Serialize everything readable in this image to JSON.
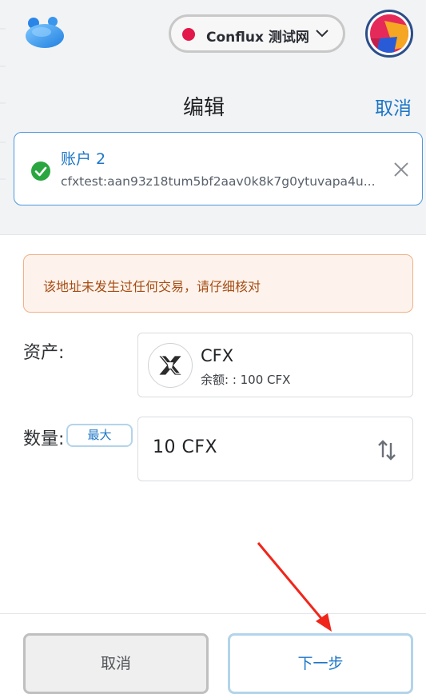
{
  "header": {
    "logo_icon": "fluent-wallet-logo-icon",
    "network": {
      "label": "Conflux 测试网",
      "status_color": "#e2184a",
      "chevron_icon": "chevron-down-icon"
    },
    "avatar_icon": "account-avatar-icon"
  },
  "page": {
    "title": "编辑",
    "cancel_label": "取消"
  },
  "account": {
    "status_icon": "check-circle-icon",
    "name": "账户 2",
    "address": "cfxtest:aan93z18tum5bf2aav0k8k7g0ytuvapa4u...",
    "clear_icon": "close-icon"
  },
  "warning": {
    "text": "该地址未发生过任何交易，请仔细核对"
  },
  "asset": {
    "label": "资产:",
    "symbol": "CFX",
    "balance": "余额: : 100 CFX",
    "token_icon": "conflux-token-icon"
  },
  "amount": {
    "label": "数量:",
    "max_label": "最大",
    "value": "10 CFX",
    "swap_icon": "swap-vertical-icon"
  },
  "footer": {
    "cancel_label": "取消",
    "next_label": "下一步"
  },
  "colors": {
    "accent": "#1c76c7",
    "success": "#2aa640",
    "warning_text": "#a64c14",
    "annotation_arrow": "#f0261b"
  }
}
